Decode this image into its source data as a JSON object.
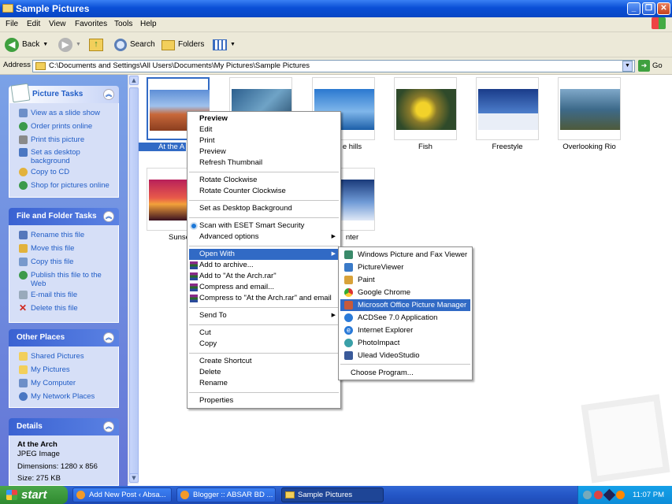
{
  "window": {
    "title": "Sample Pictures"
  },
  "menubar": [
    "File",
    "Edit",
    "View",
    "Favorites",
    "Tools",
    "Help"
  ],
  "toolbar": {
    "back": "Back",
    "search": "Search",
    "folders": "Folders"
  },
  "address": {
    "label": "Address",
    "path": "C:\\Documents and Settings\\All Users\\Documents\\My Pictures\\Sample Pictures",
    "go": "Go"
  },
  "sidebar": {
    "picture_tasks": {
      "title": "Picture Tasks",
      "items": [
        "View as a slide show",
        "Order prints online",
        "Print this picture",
        "Set as desktop background",
        "Copy to CD",
        "Shop for pictures online"
      ]
    },
    "file_folder_tasks": {
      "title": "File and Folder Tasks",
      "items": [
        "Rename this file",
        "Move this file",
        "Copy this file",
        "Publish this file to the Web",
        "E-mail this file",
        "Delete this file"
      ]
    },
    "other_places": {
      "title": "Other Places",
      "items": [
        "Shared Pictures",
        "My Pictures",
        "My Computer",
        "My Network Places"
      ]
    },
    "details": {
      "title": "Details",
      "name": "At the Arch",
      "type": "JPEG Image",
      "dimensions": "Dimensions: 1280 x 856",
      "size": "Size: 275 KB"
    }
  },
  "files": [
    "At the A",
    "",
    "e hills",
    "Fish",
    "Freestyle",
    "Overlooking Rio",
    "Sunse",
    "nter"
  ],
  "context_menu": {
    "group1": [
      "Preview",
      "Edit",
      "Print",
      "Preview",
      "Refresh Thumbnail"
    ],
    "group2": [
      "Rotate Clockwise",
      "Rotate Counter Clockwise"
    ],
    "group3": [
      "Set as Desktop Background"
    ],
    "group4": [
      "Scan with ESET Smart Security",
      "Advanced options"
    ],
    "group5": [
      "Open With",
      "Add to archive...",
      "Add to \"At the Arch.rar\"",
      "Compress and email...",
      "Compress to \"At the Arch.rar\" and email"
    ],
    "group6": [
      "Send To"
    ],
    "group7": [
      "Cut",
      "Copy"
    ],
    "group8": [
      "Create Shortcut",
      "Delete",
      "Rename"
    ],
    "group9": [
      "Properties"
    ]
  },
  "open_with": {
    "items": [
      "Windows Picture and Fax Viewer",
      "PictureViewer",
      "Paint",
      "Google Chrome",
      "Microsoft Office Picture Manager",
      "ACDSee 7.0 Application",
      "Internet Explorer",
      "PhotoImpact",
      "Ulead VideoStudio"
    ],
    "choose": "Choose Program..."
  },
  "taskbar": {
    "start": "start",
    "buttons": [
      "Add New Post ‹ Absa...",
      "Blogger :: ABSAR BD ...",
      "Sample Pictures"
    ],
    "clock": "11:07 PM"
  },
  "icons": {
    "folder": "folder-icon",
    "back": "back-arrow-icon",
    "forward": "forward-arrow-icon",
    "up": "up-folder-icon",
    "search": "search-icon",
    "folders": "folders-icon",
    "views": "views-icon",
    "go": "go-arrow-icon"
  }
}
